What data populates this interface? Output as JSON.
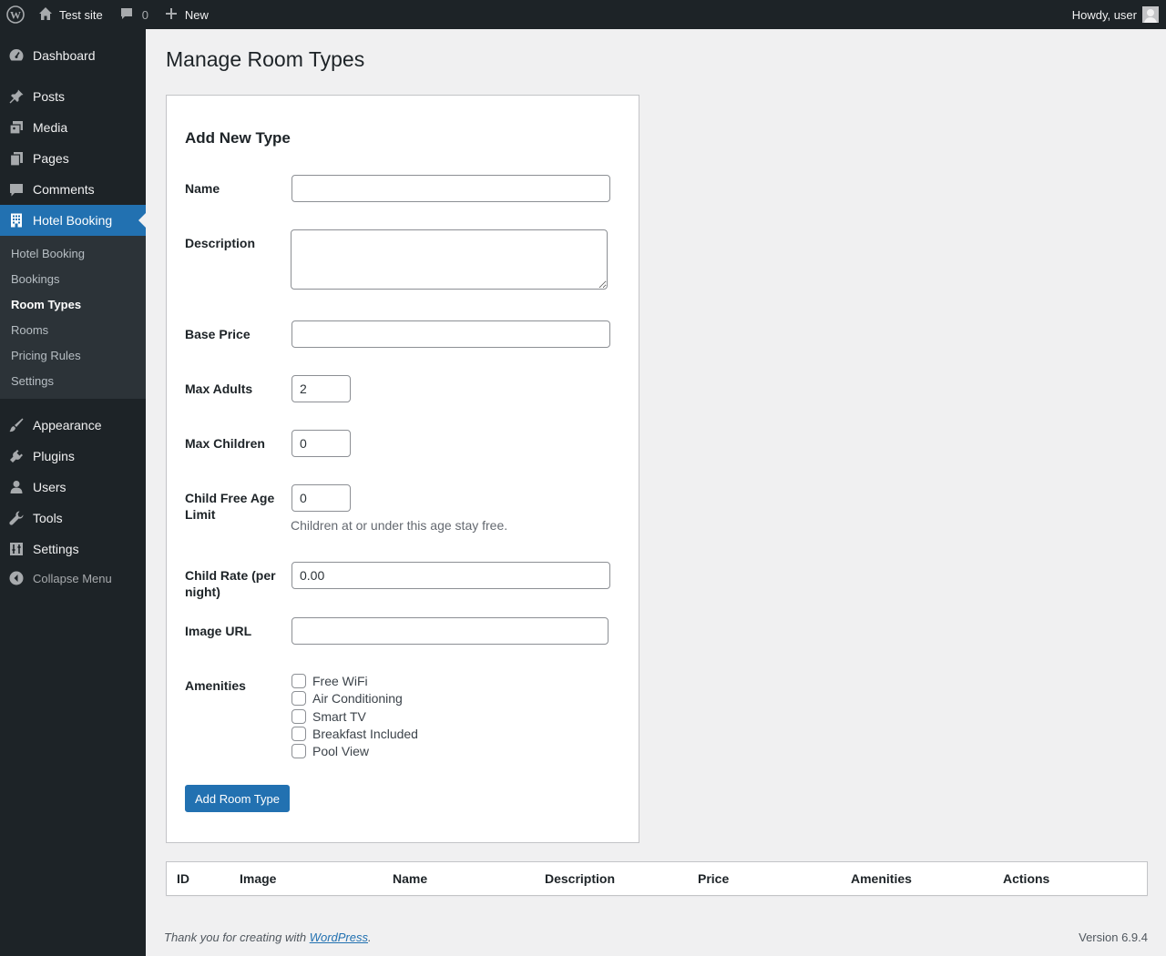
{
  "adminbar": {
    "site_name": "Test site",
    "comments_count": "0",
    "new_label": "New",
    "howdy": "Howdy, user"
  },
  "sidebar": {
    "menu": [
      {
        "label": "Dashboard",
        "icon": "dashboard-icon"
      },
      {
        "label": "Posts",
        "icon": "pin-icon"
      },
      {
        "label": "Media",
        "icon": "media-icon"
      },
      {
        "label": "Pages",
        "icon": "pages-icon"
      },
      {
        "label": "Comments",
        "icon": "comment-icon"
      },
      {
        "label": "Hotel Booking",
        "icon": "building-icon"
      },
      {
        "label": "Appearance",
        "icon": "brush-icon"
      },
      {
        "label": "Plugins",
        "icon": "plug-icon"
      },
      {
        "label": "Users",
        "icon": "user-icon"
      },
      {
        "label": "Tools",
        "icon": "wrench-icon"
      },
      {
        "label": "Settings",
        "icon": "settings-icon"
      }
    ],
    "submenu": [
      "Hotel Booking",
      "Bookings",
      "Room Types",
      "Rooms",
      "Pricing Rules",
      "Settings"
    ],
    "collapse_label": "Collapse Menu"
  },
  "page": {
    "title": "Manage Room Types",
    "form": {
      "heading": "Add New Type",
      "labels": {
        "name": "Name",
        "description": "Description",
        "base_price": "Base Price",
        "max_adults": "Max Adults",
        "max_children": "Max Children",
        "child_free_age": "Child Free Age Limit",
        "child_rate": "Child Rate (per night)",
        "image_url": "Image URL",
        "amenities": "Amenities"
      },
      "values": {
        "name": "",
        "description": "",
        "base_price": "",
        "max_adults": "2",
        "max_children": "0",
        "child_free_age": "0",
        "child_rate": "0.00",
        "image_url": ""
      },
      "child_free_help": "Children at or under this age stay free.",
      "amenities": [
        "Free WiFi",
        "Air Conditioning",
        "Smart TV",
        "Breakfast Included",
        "Pool View"
      ],
      "submit_label": "Add Room Type"
    },
    "table": {
      "columns": [
        "ID",
        "Image",
        "Name",
        "Description",
        "Price",
        "Amenities",
        "Actions"
      ]
    }
  },
  "footer": {
    "thanks_prefix": "Thank you for creating with ",
    "thanks_link": "WordPress",
    "thanks_suffix": ".",
    "version": "Version 6.9.4"
  },
  "colors": {
    "admin_dark": "#1d2327",
    "accent_blue": "#2271b1",
    "submenu_bg": "#2c3338",
    "page_bg": "#f0f0f1"
  }
}
